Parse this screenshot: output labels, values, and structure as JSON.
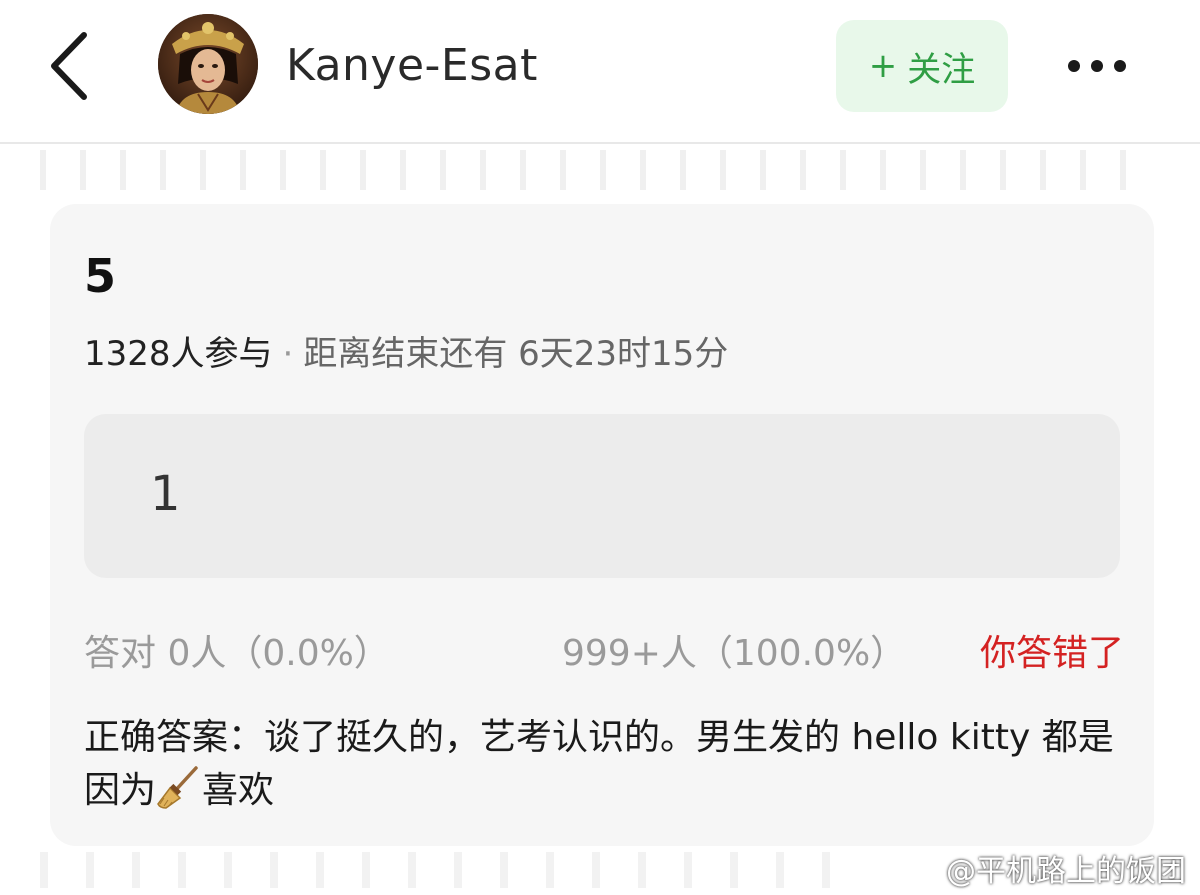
{
  "header": {
    "username": "Kanye-Esat",
    "follow_plus": "+",
    "follow_label": "关注",
    "back_icon": "chevron-left-icon",
    "more_icon": "more-horizontal-icon"
  },
  "quiz": {
    "title": "5",
    "participants": "1328人参与",
    "separator": "·",
    "countdown": "距离结束还有 6天23时15分",
    "my_answer": "1",
    "stats": {
      "correct": "答对  0人（0.0%）",
      "total": "999+人（100.0%）",
      "result": "你答错了"
    },
    "reveal_part1": "正确答案：谈了挺久的，艺考认识的。男生发的 hello kitty 都是因为",
    "reveal_icon": "broom-icon",
    "reveal_part2": "喜欢"
  },
  "watermark": {
    "text": "@平机路上的饭团",
    "icon": "weibo-icon"
  },
  "colors": {
    "follow_bg": "#e8f8ea",
    "follow_text": "#2f9e44",
    "wrong_text": "#d42222",
    "card_bg": "#f6f6f6",
    "answer_bg": "#ececec"
  }
}
